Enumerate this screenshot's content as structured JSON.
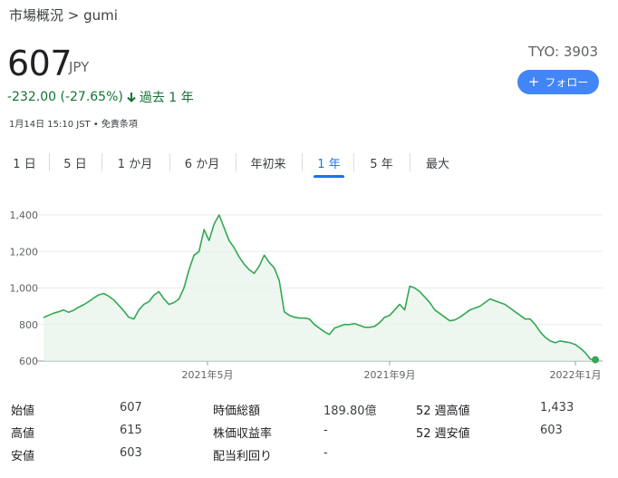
{
  "breadcrumb": "市場概況 > gumi",
  "price": "607",
  "currency": "JPY",
  "ticker": "TYO: 3903",
  "follow_label": "フォロー",
  "change": {
    "text": "-232.00 (-27.65%)",
    "period": "過去 1 年",
    "color": "#137333"
  },
  "timestamp": "1月14日 15:10 JST • 免責条項",
  "tabs": [
    "1 日",
    "5 日",
    "1 か月",
    "6 か月",
    "年初来",
    "1 年",
    "5 年",
    "最大"
  ],
  "active_tab": "1 年",
  "chart_data": {
    "type": "area",
    "x_tick_labels": [
      "2021年5月",
      "2021年9月",
      "2022年1月"
    ],
    "y_tick_labels": [
      "1,400",
      "1,200",
      "1,000",
      "800",
      "600"
    ],
    "ylim": [
      600,
      1400
    ],
    "grid": true,
    "line_color": "#34a853",
    "fill_color": "#e6f4ea",
    "series": [
      {
        "values": [
          838,
          850,
          862,
          870,
          880,
          867,
          878,
          895,
          908,
          925,
          945,
          962,
          970,
          955,
          935,
          905,
          875,
          840,
          830,
          880,
          910,
          925,
          960,
          980,
          940,
          910,
          920,
          940,
          1000,
          1100,
          1180,
          1200,
          1320,
          1260,
          1350,
          1400,
          1330,
          1260,
          1220,
          1170,
          1130,
          1100,
          1080,
          1120,
          1180,
          1140,
          1110,
          1040,
          870,
          850,
          840,
          835,
          835,
          830,
          800,
          780,
          760,
          745,
          780,
          790,
          800,
          800,
          805,
          795,
          785,
          785,
          790,
          810,
          840,
          850,
          880,
          910,
          880,
          1010,
          1000,
          980,
          950,
          920,
          880,
          860,
          840,
          820,
          825,
          840,
          860,
          880,
          890,
          900,
          920,
          940,
          930,
          920,
          910,
          890,
          870,
          850,
          830,
          830,
          800,
          760,
          730,
          710,
          700,
          710,
          705,
          700,
          690,
          670,
          645,
          610,
          607
        ]
      }
    ]
  },
  "stats": [
    {
      "label": "始値",
      "value": "607"
    },
    {
      "label": "高値",
      "value": "615"
    },
    {
      "label": "安値",
      "value": "603"
    },
    {
      "label": "時価総額",
      "value": "189.80億"
    },
    {
      "label": "株価収益率",
      "value": "-"
    },
    {
      "label": "配当利回り",
      "value": "-"
    },
    {
      "label": "52 週高値",
      "value": "1,433"
    },
    {
      "label": "52 週安値",
      "value": "603"
    }
  ]
}
